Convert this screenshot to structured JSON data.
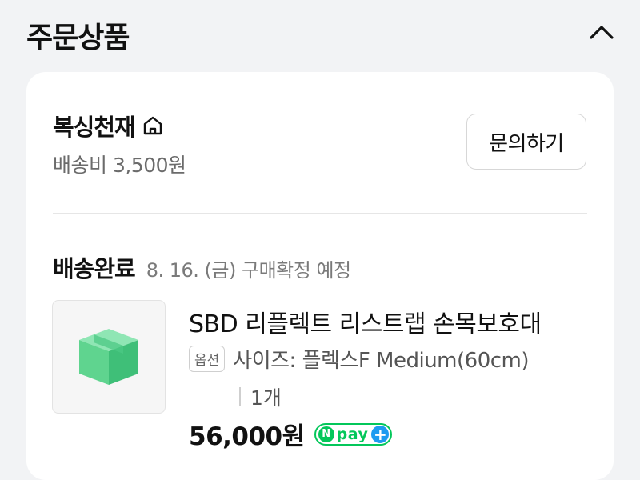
{
  "header": {
    "title": "주문상품"
  },
  "seller": {
    "name": "복싱천재",
    "shipping_fee": "배송비 3,500원",
    "inquiry_label": "문의하기"
  },
  "order": {
    "status": "배송완료",
    "status_detail": "8. 16. (금) 구매확정 예정",
    "product": {
      "name": "SBD 리플렉트 리스트랩 손목보호대",
      "option_badge": "옵션",
      "option_text": "사이즈: 플렉스F Medium(60cm)",
      "quantity": "1개",
      "price": "56,000원"
    },
    "payment_badge": {
      "n": "N",
      "text": "pay",
      "plus": "+"
    }
  },
  "colors": {
    "accent_green": "#03c75a",
    "plus_blue": "#1e9bf0",
    "box_green": "#5fd48f"
  },
  "icons": [
    "chevron-up-icon",
    "home-icon",
    "package-box-icon"
  ]
}
